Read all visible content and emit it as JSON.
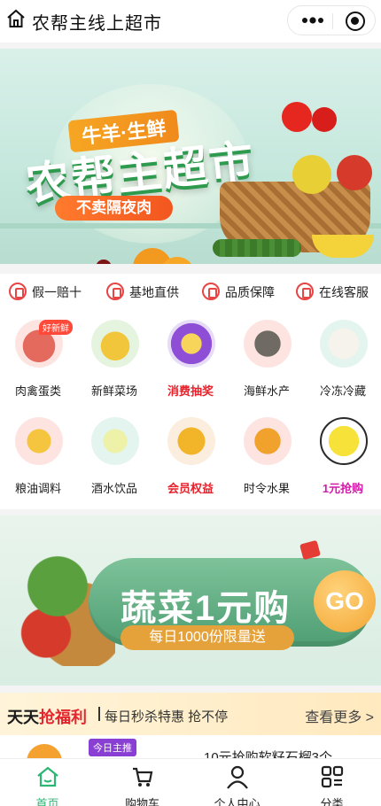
{
  "header": {
    "title": "农帮主线上超市",
    "home_icon": "home-icon",
    "more_icon": "more-dots-icon",
    "target_icon": "target-icon"
  },
  "banner": {
    "sub": "牛羊·生鲜",
    "main": "农帮主超市",
    "slogan": "不卖隔夜肉"
  },
  "features": [
    {
      "label": "假一赔十",
      "icon": "shield-icon"
    },
    {
      "label": "基地直供",
      "icon": "location-icon"
    },
    {
      "label": "品质保障",
      "icon": "quality-icon"
    },
    {
      "label": "在线客服",
      "icon": "support-icon"
    }
  ],
  "categories": [
    {
      "label": "肉禽蛋类",
      "badge": "好新鲜"
    },
    {
      "label": "新鲜菜场"
    },
    {
      "label": "消费抽奖"
    },
    {
      "label": "海鲜水产"
    },
    {
      "label": "冷冻冷藏"
    },
    {
      "label": "粮油调料"
    },
    {
      "label": "酒水饮品"
    },
    {
      "label": "会员权益"
    },
    {
      "label": "时令水果"
    },
    {
      "label": "1元抢购"
    }
  ],
  "promo": {
    "headline": "蔬菜1元购",
    "subline": "每日1000份限量送",
    "go": "GO"
  },
  "deals": {
    "title_a": "天天",
    "title_b": "抢福利",
    "subtitle": "每日秒杀特惠 抢不停",
    "more": "查看更多 >",
    "tag": "今日主推",
    "item_name": "10元抢购软籽石榴3个"
  },
  "tabbar": [
    {
      "label": "首页",
      "active": true
    },
    {
      "label": "购物车"
    },
    {
      "label": "个人中心"
    },
    {
      "label": "分类"
    }
  ],
  "colors": {
    "accent_green": "#2bb673",
    "highlight_red": "#e3262d",
    "promo_green": "#4f9e73"
  }
}
